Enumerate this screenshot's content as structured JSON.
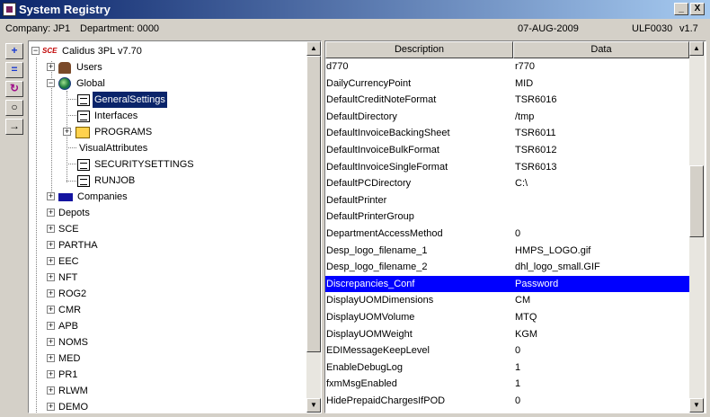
{
  "window": {
    "title": "System Registry",
    "min_label": "_",
    "close_label": "X"
  },
  "status": {
    "company": "Company:  JP1",
    "department": "Department:  0000",
    "date": "07-AUG-2009",
    "program": "ULF0030",
    "version": "v1.7"
  },
  "toolbar": {
    "expand_all": "+",
    "collapse_all": "=",
    "refresh": "↻",
    "find": "○",
    "goto": "→"
  },
  "tree": {
    "root": {
      "logo": "SCE",
      "label": "Calidus 3PL v7.70"
    },
    "users": "Users",
    "global": "Global",
    "general_settings": "GeneralSettings",
    "interfaces": "Interfaces",
    "programs": "PROGRAMS",
    "visual_attributes": "VisualAttributes",
    "security_settings": "SECURITYSETTINGS",
    "runjob": "RUNJOB",
    "companies": "Companies",
    "others": [
      "Depots",
      "SCE",
      "PARTHA",
      "EEC",
      "NFT",
      "ROG2",
      "CMR",
      "APB",
      "NOMS",
      "MED",
      "PR1",
      "RLWM",
      "DEMO"
    ]
  },
  "grid": {
    "headers": {
      "description": "Description",
      "data": "Data"
    },
    "rows": [
      {
        "d": "d770",
        "v": "r770"
      },
      {
        "d": "DailyCurrencyPoint",
        "v": "MID"
      },
      {
        "d": "DefaultCreditNoteFormat",
        "v": "TSR6016"
      },
      {
        "d": "DefaultDirectory",
        "v": "/tmp"
      },
      {
        "d": "DefaultInvoiceBackingSheet",
        "v": "TSR6011"
      },
      {
        "d": "DefaultInvoiceBulkFormat",
        "v": "TSR6012"
      },
      {
        "d": "DefaultInvoiceSingleFormat",
        "v": "TSR6013"
      },
      {
        "d": "DefaultPCDirectory",
        "v": "C:\\"
      },
      {
        "d": "DefaultPrinter",
        "v": ""
      },
      {
        "d": "DefaultPrinterGroup",
        "v": ""
      },
      {
        "d": "DepartmentAccessMethod",
        "v": "0"
      },
      {
        "d": "Desp_logo_filename_1",
        "v": "HMPS_LOGO.gif"
      },
      {
        "d": "Desp_logo_filename_2",
        "v": "dhl_logo_small.GIF"
      },
      {
        "d": "Discrepancies_Conf",
        "v": "Password",
        "selected": true
      },
      {
        "d": "DisplayUOMDimensions",
        "v": "CM"
      },
      {
        "d": "DisplayUOMVolume",
        "v": "MTQ"
      },
      {
        "d": "DisplayUOMWeight",
        "v": "KGM"
      },
      {
        "d": "EDIMessageKeepLevel",
        "v": "0"
      },
      {
        "d": "EnableDebugLog",
        "v": "1"
      },
      {
        "d": "fxmMsgEnabled",
        "v": "1"
      },
      {
        "d": "HidePrepaidChargesIfPOD",
        "v": "0"
      }
    ]
  }
}
